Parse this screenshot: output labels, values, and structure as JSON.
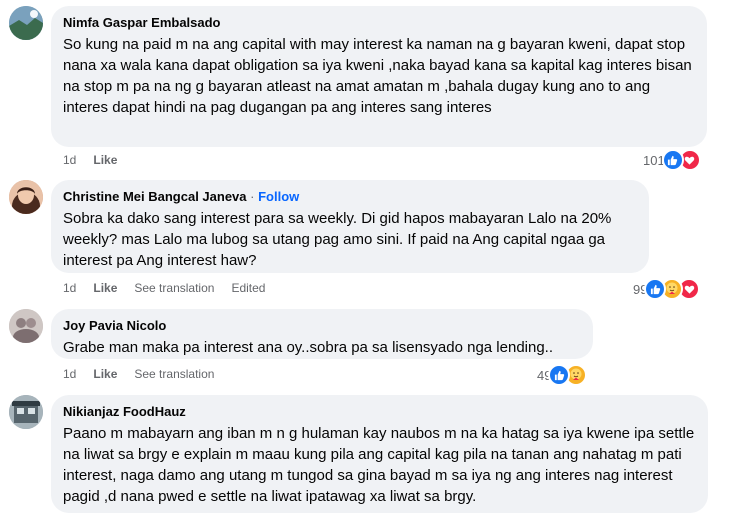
{
  "comments": [
    {
      "author": "Nimfa Gaspar Embalsado",
      "text": "So kung na paid m na ang capital with may interest ka naman na g bayaran kweni, dapat stop nana xa wala kana dapat obligation sa iya kweni ,naka bayad kana sa kapital kag interes bisan na stop m pa na ng g bayaran atleast na amat amatan m ,bahala dugay kung ano to ang interes dapat hindi na pag dugangan pa ang interes sang interes",
      "time": "1d",
      "like": "Like",
      "reaction_count": "101",
      "reactions": [
        "like-icon",
        "love-icon"
      ]
    },
    {
      "author": "Christine Mei Bangcal Janeva",
      "separator": "·",
      "follow": "Follow",
      "text": "Sobra ka dako sang interest para sa weekly. Di gid hapos mabayaran Lalo na 20% weekly? mas Lalo ma lubog sa utang pag amo sini. If paid na Ang capital ngaa ga interest pa Ang interest haw?",
      "time": "1d",
      "like": "Like",
      "translate": "See translation",
      "edited": "Edited",
      "reaction_count": "99",
      "reactions": [
        "like-icon",
        "care-icon",
        "love-icon"
      ]
    },
    {
      "author": "Joy Pavia Nicolo",
      "text": "Grabe man maka pa interest ana oy..sobra pa sa lisensyado nga lending..",
      "time": "1d",
      "like": "Like",
      "translate": "See translation",
      "reaction_count": "49",
      "reactions": [
        "like-icon",
        "care-icon"
      ]
    },
    {
      "author": "Nikianjaz FoodHauz",
      "text": "Paano m mabayarn ang iban m n g hulaman kay naubos m na ka hatag sa iya kwene ipa settle na liwat sa brgy e explain m maau kung pila ang capital kag pila na tanan ang nahatag m pati interest, naga damo ang utang m tungod sa gina bayad m sa iya ng ang interes nag interest pagid ,d nana pwed e settle na liwat ipatawag xa liwat sa brgy."
    }
  ],
  "colors": {
    "bubble": "#f0f2f5",
    "link": "#0866ff",
    "meta": "#65676b",
    "like": "#1877f2",
    "love": "#f02849",
    "care": "#f7b125"
  }
}
